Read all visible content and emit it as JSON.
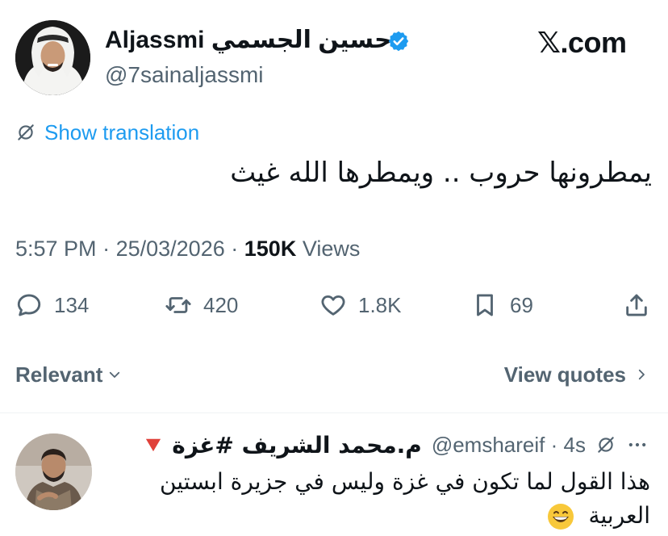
{
  "tweet": {
    "author_name": "Aljassmi حسين الجسمي",
    "handle": "@7sainaljassmi",
    "brand": "𝕏.com",
    "translate_label": "Show translation",
    "text": "يمطرونها حروب .. ويمطرها الله غيث",
    "time": "5:57 PM",
    "date": "25/03/2026",
    "views_count": "150K",
    "views_label": "Views",
    "separator": "·"
  },
  "actions": {
    "replies": "134",
    "reposts": "420",
    "likes": "1.8K",
    "bookmarks": "69"
  },
  "filters": {
    "sort_label": "Relevant",
    "quotes_label": "View quotes"
  },
  "reply": {
    "name": "م.محمد الشريف #غزة",
    "handle": "@emshareif",
    "time": "4s",
    "separator": "·",
    "text": "هذا القول لما تكون في غزة وليس في جزيرة ابستين العربية"
  },
  "icons": {
    "verified": "verified-badge-icon",
    "translate": "translate-slash-icon",
    "reply": "speech-bubble-icon",
    "repost": "repost-arrows-icon",
    "like": "heart-icon",
    "bookmark": "bookmark-icon",
    "share": "share-upload-icon",
    "more": "ellipsis-icon",
    "flag": "red-triangle-icon",
    "emoji": "grinning-face-icon"
  },
  "colors": {
    "accent": "#1d9bf0",
    "text": "#0f1419",
    "muted": "#536471",
    "divider": "#eff3f4"
  }
}
